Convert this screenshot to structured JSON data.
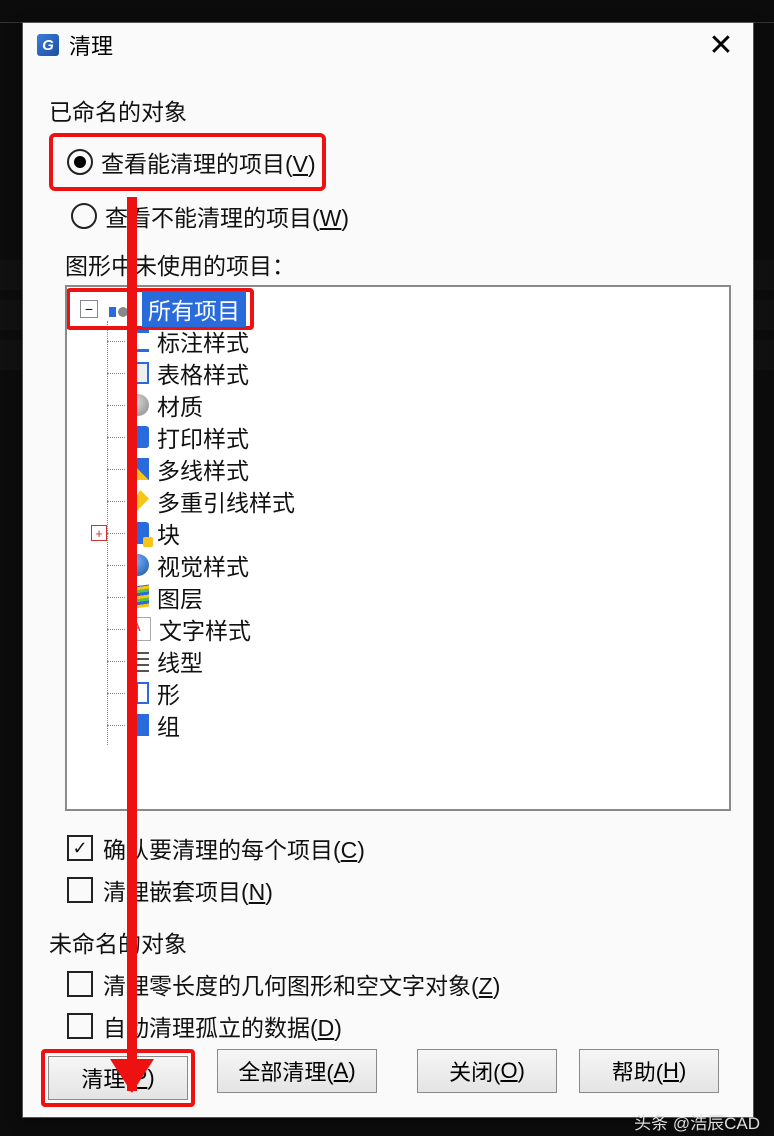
{
  "window": {
    "title": "清理"
  },
  "group_named": {
    "label": "已命名的对象",
    "radio_purgeable": "查看能清理的项目(V)",
    "radio_not_purgeable": "查看不能清理的项目(W)",
    "tree_label": "图形中未使用的项目：",
    "root": "所有项目",
    "items": [
      {
        "label": "标注样式",
        "icon": "ic-dim"
      },
      {
        "label": "表格样式",
        "icon": "ic-tab"
      },
      {
        "label": "材质",
        "icon": "ic-mat"
      },
      {
        "label": "打印样式",
        "icon": "ic-plt"
      },
      {
        "label": "多线样式",
        "icon": "ic-ml"
      },
      {
        "label": "多重引线样式",
        "icon": "ic-mld"
      },
      {
        "label": "块",
        "icon": "ic-blk",
        "expandable": true
      },
      {
        "label": "视觉样式",
        "icon": "ic-vis"
      },
      {
        "label": "图层",
        "icon": "ic-lay"
      },
      {
        "label": "文字样式",
        "icon": "ic-txt"
      },
      {
        "label": "线型",
        "icon": "ic-lt"
      },
      {
        "label": "形",
        "icon": "ic-shp"
      },
      {
        "label": "组",
        "icon": "ic-grp"
      }
    ],
    "confirm": "确认要清理的每个项目(C)",
    "nested": "清理嵌套项目(N)"
  },
  "group_unnamed": {
    "label": "未命名的对象",
    "zero_len": "清理零长度的几何图形和空文字对象(Z)",
    "orphan": "自动清理孤立的数据(D)"
  },
  "buttons": {
    "purge": "清理(P)",
    "purge_all": "全部清理(A)",
    "close": "关闭(O)",
    "help": "帮助(H)"
  },
  "watermark": "头条 @浩辰CAD"
}
